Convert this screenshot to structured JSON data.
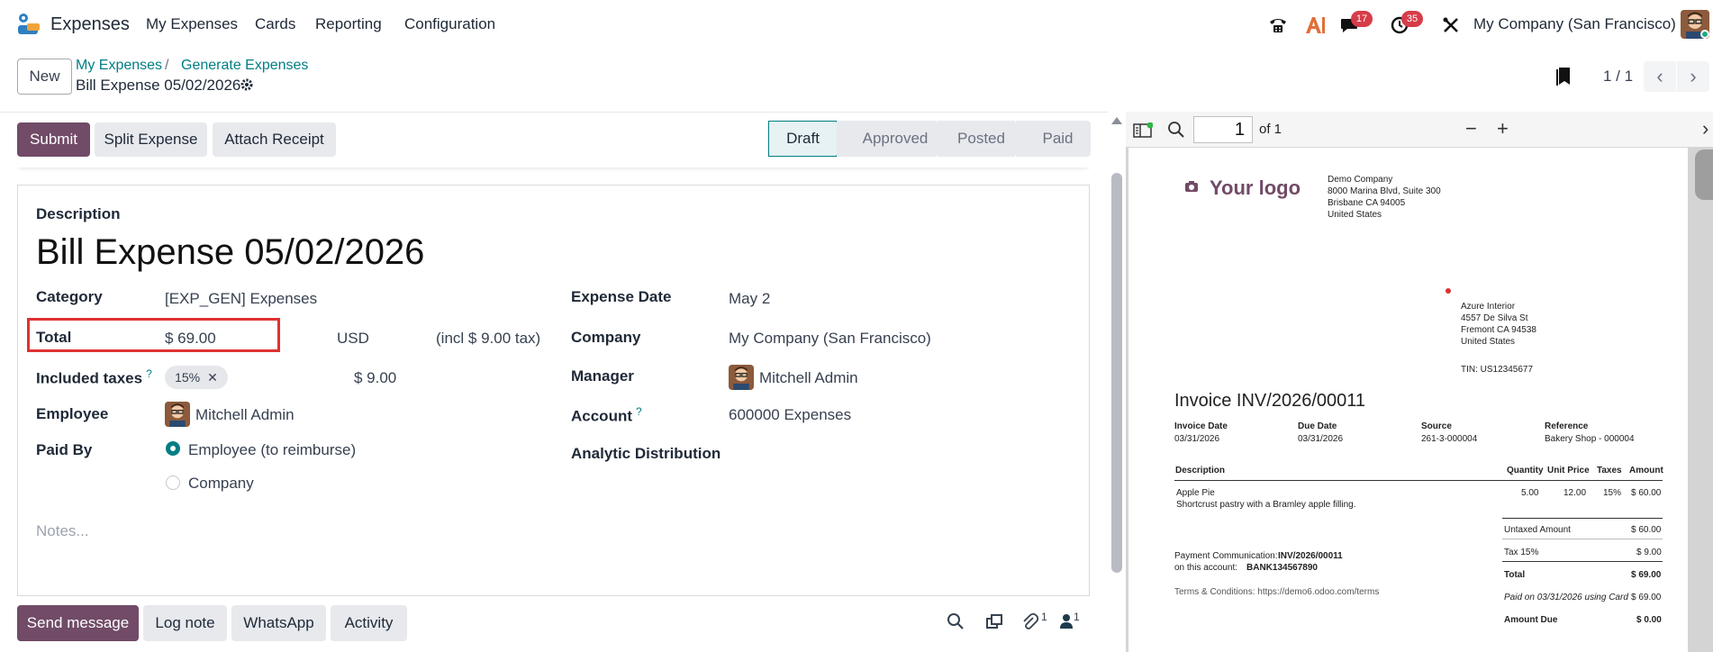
{
  "navbar": {
    "app_name": "Expenses",
    "menus": [
      "My Expenses",
      "Cards",
      "Reporting",
      "Configuration"
    ],
    "messages_badge": "17",
    "activities_badge": "35",
    "company": "My Company (San Francisco)",
    "icons": [
      "phone-icon",
      "ai-icon",
      "chat-icon",
      "clock-icon",
      "tools-icon"
    ]
  },
  "control_panel": {
    "new_label": "New",
    "breadcrumb": [
      "My Expenses",
      "Generate Expenses"
    ],
    "breadcrumb_sep": "/",
    "record_title": "Bill Expense 05/02/2026",
    "pager": "1 / 1"
  },
  "statusbar": {
    "buttons": [
      "Submit",
      "Split Expense",
      "Attach Receipt"
    ],
    "stages": [
      "Draft",
      "Approved",
      "Posted",
      "Paid"
    ],
    "active_stage": "Draft"
  },
  "form": {
    "description_label": "Description",
    "description": "Bill Expense 05/02/2026",
    "category_label": "Category",
    "category": "[EXP_GEN] Expenses",
    "total_label": "Total",
    "total": "$ 69.00",
    "currency": "USD",
    "incl_tax": "(incl $ 9.00 tax)",
    "included_taxes_label": "Included taxes",
    "tax_tag": "15%",
    "tax_amount": "$ 9.00",
    "employee_label": "Employee",
    "employee": "Mitchell Admin",
    "paid_by_label": "Paid By",
    "paid_by_options": [
      "Employee (to reimburse)",
      "Company"
    ],
    "paid_by_selected": "Employee (to reimburse)",
    "expense_date_label": "Expense Date",
    "expense_date": "May 2",
    "company_label": "Company",
    "company": "My Company (San Francisco)",
    "manager_label": "Manager",
    "manager": "Mitchell Admin",
    "account_label": "Account",
    "account": "600000 Expenses",
    "analytic_label": "Analytic Distribution",
    "notes_placeholder": "Notes...",
    "help_mark": "?"
  },
  "chatter": {
    "buttons": [
      "Send message",
      "Log note",
      "WhatsApp",
      "Activity"
    ],
    "attachments_count": "1",
    "followers_count": "1"
  },
  "pdf": {
    "page": "1",
    "of": "of 1",
    "logo": "Your logo",
    "sender": [
      "Demo Company",
      "8000 Marina Blvd, Suite 300",
      "Brisbane CA 94005",
      "United States"
    ],
    "recipient": [
      "Azure Interior",
      "4557 De Silva St",
      "Fremont CA 94538",
      "United States"
    ],
    "tin": "TIN: US12345677",
    "invoice_title": "Invoice INV/2026/00011",
    "meta_labels": [
      "Invoice Date",
      "Due Date",
      "Source",
      "Reference"
    ],
    "meta_values": [
      "03/31/2026",
      "03/31/2026",
      "261-3-000004",
      "Bakery Shop - 000004"
    ],
    "table_headers": [
      "Description",
      "Quantity",
      "Unit Price",
      "Taxes",
      "Amount"
    ],
    "line": {
      "product": "Apple Pie",
      "desc": "Shortcrust pastry with a Bramley apple filling.",
      "qty": "5.00",
      "price": "12.00",
      "tax": "15%",
      "amount": "$ 60.00"
    },
    "totals": [
      {
        "label": "Untaxed Amount",
        "value": "$ 60.00"
      },
      {
        "label": "Tax 15%",
        "value": "$ 9.00"
      },
      {
        "label": "Total",
        "value": "$ 69.00"
      },
      {
        "label": "Paid on 03/31/2026 using Card",
        "value": "$ 69.00"
      },
      {
        "label": "Amount Due",
        "value": "$ 0.00"
      }
    ],
    "payment_comm_label": "Payment Communication:",
    "payment_comm": "INV/2026/00011",
    "account_label": "on this account:",
    "account": "BANK134567890",
    "terms": "Terms & Conditions: https://demo6.odoo.com/terms"
  }
}
